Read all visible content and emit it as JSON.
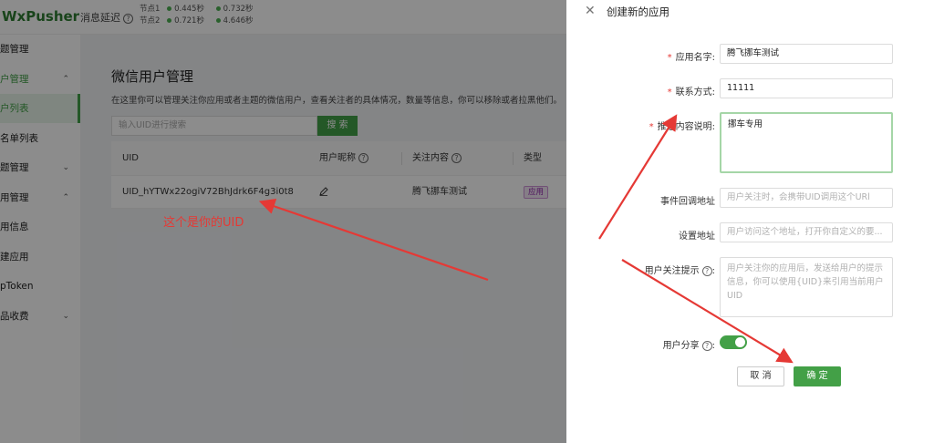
{
  "app": {
    "logo": "WxPusher",
    "delay_label": "消息延迟",
    "nodes": [
      {
        "label": "节点1",
        "v1": "0.445秒",
        "v2": "0.732秒"
      },
      {
        "label": "节点2",
        "v1": "0.721秒",
        "v2": "4.646秒"
      }
    ]
  },
  "sidebar": {
    "items": [
      {
        "label": "题管理",
        "state": "normal"
      },
      {
        "label": "户管理",
        "state": "active",
        "chevron": "chevron-up"
      },
      {
        "label": "户列表",
        "state": "selected"
      },
      {
        "label": "名单列表",
        "state": "normal"
      },
      {
        "label": "题管理",
        "state": "normal",
        "chevron": "chevron-down"
      },
      {
        "label": "用管理",
        "state": "normal",
        "chevron": "chevron-up"
      },
      {
        "label": "用信息",
        "state": "normal"
      },
      {
        "label": "建应用",
        "state": "normal"
      },
      {
        "label": "pToken",
        "state": "normal"
      },
      {
        "label": "品收费",
        "state": "normal",
        "chevron": "chevron-down"
      }
    ]
  },
  "main": {
    "title": "微信用户管理",
    "description": "在这里你可以管理关注你应用或者主题的微信用户，查看关注者的具体情况，数量等信息，你可以移除或者拉黑他们。",
    "search_placeholder": "输入UID进行搜索",
    "search_button": "搜 索",
    "table": {
      "headers": [
        "UID",
        "用户昵称",
        "关注内容",
        "类型"
      ],
      "rows": [
        {
          "uid": "UID_hYTWx22ogiV72BhJdrk6F4g3i0t8",
          "content": "腾飞挪车测试",
          "type": "应用"
        }
      ]
    }
  },
  "annotation": "这个是你的UID",
  "drawer": {
    "title": "创建新的应用",
    "fields": {
      "app_name": {
        "label": "应用名字:",
        "value": "腾飞挪车测试",
        "required": true
      },
      "contact": {
        "label": "联系方式:",
        "value": "11111",
        "required": true
      },
      "push_desc": {
        "label": "推送内容说明:",
        "value": "挪车专用",
        "required": true
      },
      "callback": {
        "label": "事件回调地址",
        "placeholder": "用户关注时，会携带UID调用这个URl"
      },
      "setting_url": {
        "label": "设置地址",
        "placeholder": "用户访问这个地址，打开你自定义的要..."
      },
      "follow_tip": {
        "label": "用户关注提示",
        "placeholder": "用户关注你的应用后，发送给用户的提示信息，你可以使用{UID}来引用当前用户UID"
      },
      "share": {
        "label": "用户分享",
        "enabled": true
      }
    },
    "cancel_label": "取 消",
    "ok_label": "确 定"
  },
  "colors": {
    "accent": "#43a047",
    "annotation": "#e53935"
  }
}
